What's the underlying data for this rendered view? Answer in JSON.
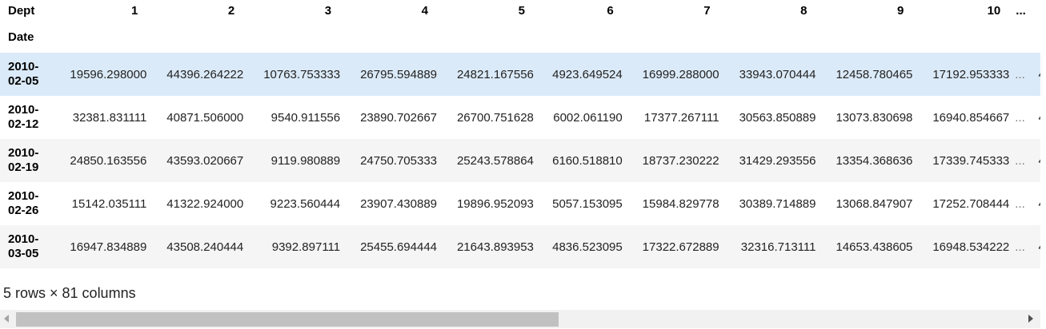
{
  "table": {
    "columns_name": "Dept",
    "index_name": "Date",
    "columns": [
      "1",
      "2",
      "3",
      "4",
      "5",
      "6",
      "7",
      "8",
      "9",
      "10",
      "..."
    ],
    "rows": [
      {
        "index": "2010-02-05",
        "values": [
          "19596.298000",
          "44396.264222",
          "10763.753333",
          "26795.594889",
          "24821.167556",
          "4923.649524",
          "16999.288000",
          "33943.070444",
          "12458.780465",
          "17192.953333"
        ],
        "ellipsis": "...",
        "truncated": "4"
      },
      {
        "index": "2010-02-12",
        "values": [
          "32381.831111",
          "40871.506000",
          "9540.911556",
          "23890.702667",
          "26700.751628",
          "6002.061190",
          "17377.267111",
          "30563.850889",
          "13073.830698",
          "16940.854667"
        ],
        "ellipsis": "...",
        "truncated": "4"
      },
      {
        "index": "2010-02-19",
        "values": [
          "24850.163556",
          "43593.020667",
          "9119.980889",
          "24750.705333",
          "25243.578864",
          "6160.518810",
          "18737.230222",
          "31429.293556",
          "13354.368636",
          "17339.745333"
        ],
        "ellipsis": "...",
        "truncated": "4"
      },
      {
        "index": "2010-02-26",
        "values": [
          "15142.035111",
          "41322.924000",
          "9223.560444",
          "23907.430889",
          "19896.952093",
          "5057.153095",
          "15984.829778",
          "30389.714889",
          "13068.847907",
          "17252.708444"
        ],
        "ellipsis": "...",
        "truncated": "4"
      },
      {
        "index": "2010-03-05",
        "values": [
          "16947.834889",
          "43508.240444",
          "9392.897111",
          "25455.694444",
          "21643.893953",
          "4836.523095",
          "17322.672889",
          "32316.713111",
          "14653.438605",
          "16948.534222"
        ],
        "ellipsis": "...",
        "truncated": "4"
      }
    ],
    "hovered_row": 0
  },
  "shape_text": "5 rows × 81 columns"
}
